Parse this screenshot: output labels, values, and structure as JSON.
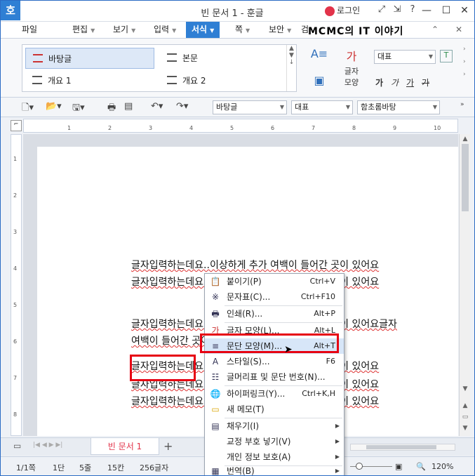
{
  "window": {
    "app_icon": "호",
    "title": "빈 문서 1 - 훈글",
    "login_label": "로그인",
    "icons": [
      "fullscreen-icon",
      "restore-arrows-icon",
      "help-icon"
    ],
    "controls": {
      "minimize": "—",
      "maximize": "☐",
      "close": "✕"
    }
  },
  "menubar": {
    "items": [
      "파일",
      "편집",
      "보기",
      "입력",
      "서식",
      "쪽",
      "보안"
    ],
    "active": "서식",
    "overlay_watermark": "MCMC의 IT 이야기",
    "extra_partial": "검"
  },
  "ribbon": {
    "styles": [
      {
        "label": "바탕글",
        "selected": true
      },
      {
        "label": "본문",
        "selected": false
      },
      {
        "label": "개요 1",
        "selected": false
      },
      {
        "label": "개요 2",
        "selected": false
      }
    ],
    "char_shape_label_1": "글자",
    "char_shape_label_2": "모양",
    "font_value": "대표",
    "format_buttons": [
      "가",
      "가",
      "가",
      "가"
    ]
  },
  "toolbar": {
    "style_combo": "바탕글",
    "font_combo": "대표",
    "fontface_combo": "함초롬바탕"
  },
  "ruler": {
    "h_ticks": [
      "1",
      "2",
      "3",
      "4",
      "5",
      "6",
      "7",
      "8",
      "9",
      "10"
    ],
    "v_ticks": [
      "1",
      "2",
      "3",
      "4",
      "5",
      "6",
      "7",
      "8"
    ]
  },
  "document": {
    "lines": [
      "글자입력하는데요..이상하게 추가 여백이 들어간 곳이 있어요",
      "글자입력하는데요..이상하게 추가 여백이 들어간 곳이 있어요",
      "글자입력하는데요..이상하게 추가 여백이 들어간 곳이 있어요글자",
      "여백이 들어간 곳이 있어요..이상하게 추가 여백",
      "글자입력하는데요..이상하게 추가 여백이 들어간 곳이 있어요",
      "글자입력하는데요..이상하게 추가 여백이 들어간 곳이 있어요",
      "글자입력하는데요..이상하게 추가 여백이 들어간 곳이 있어요"
    ]
  },
  "context_menu": {
    "items": [
      {
        "icon": "paste-icon",
        "glyph": "📋",
        "label": "붙이기(P)",
        "shortcut": "Ctrl+V"
      },
      {
        "icon": "symbol-icon",
        "glyph": "※",
        "label": "문자표(C)...",
        "shortcut": "Ctrl+F10"
      },
      {
        "icon": "print-icon",
        "glyph": "🖶",
        "label": "인쇄(R)...",
        "shortcut": "Alt+P"
      },
      {
        "icon": "char-shape-icon",
        "glyph": "가",
        "label": "글자 모양(L)...",
        "shortcut": "Alt+L"
      },
      {
        "icon": "para-shape-icon",
        "glyph": "≡",
        "label": "문단 모양(M)...",
        "shortcut": "Alt+T"
      },
      {
        "icon": "style-icon",
        "glyph": "A",
        "label": "스타일(S)...",
        "shortcut": "F6"
      },
      {
        "icon": "bullet-icon",
        "glyph": "☷",
        "label": "글머리표 및 문단 번호(N)...",
        "shortcut": ""
      },
      {
        "icon": "hyperlink-icon",
        "glyph": "🌐",
        "label": "하이퍼링크(Y)...",
        "shortcut": "Ctrl+K,H"
      },
      {
        "icon": "memo-icon",
        "glyph": "▭",
        "label": "새 메모(T)",
        "shortcut": ""
      },
      {
        "icon": "fill-icon",
        "glyph": "▤",
        "label": "채우기(I)",
        "shortcut": ""
      },
      {
        "icon": "",
        "glyph": "",
        "label": "교정 부호 넣기(V)",
        "shortcut": ""
      },
      {
        "icon": "",
        "glyph": "",
        "label": "개인 정보 보호(A)",
        "shortcut": ""
      },
      {
        "icon": "translate-icon",
        "glyph": "▦",
        "label": "번역(B)",
        "shortcut": ""
      }
    ]
  },
  "tabbar": {
    "doc_tab": "빈 문서 1",
    "add_tab": "+"
  },
  "status": {
    "page": "1/1쪽",
    "column": "1단",
    "line": "5줄",
    "col": "15칸",
    "chars": "256글자",
    "zoom": "120%"
  }
}
